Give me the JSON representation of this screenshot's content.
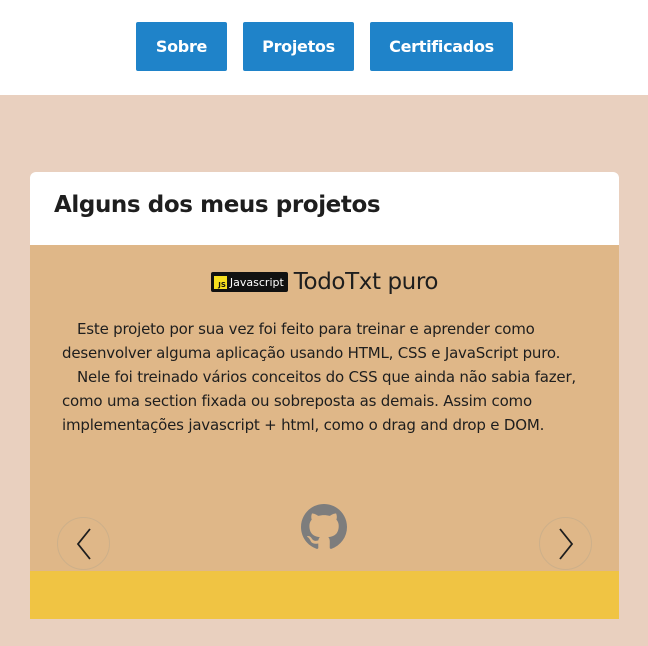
{
  "nav": {
    "about": "Sobre",
    "projects": "Projetos",
    "certificates": "Certificados"
  },
  "section": {
    "title": "Alguns dos meus projetos"
  },
  "project": {
    "tech_badge": "Javascript",
    "tech_badge_logo": "JS",
    "name": "TodoTxt puro",
    "paragraph_1": "Este projeto por sua vez foi feito para treinar e aprender como desenvolver alguma aplicação usando HTML, CSS e JavaScript puro.",
    "paragraph_2": "Nele foi treinado vários conceitos do CSS que ainda não sabia fazer, como uma section fixada ou sobreposta as demais. Assim como implementações javascript + html, como o drag and drop e DOM."
  },
  "icons": {
    "repo_link": "github-icon",
    "previous": "chevron-left-icon",
    "next": "chevron-right-icon"
  },
  "colors": {
    "page_background": "#e9d0bf",
    "nav_button": "#1f83c9",
    "card_body": "#dfb788",
    "card_footer": "#f0c443",
    "js_yellow": "#f7df1e"
  }
}
